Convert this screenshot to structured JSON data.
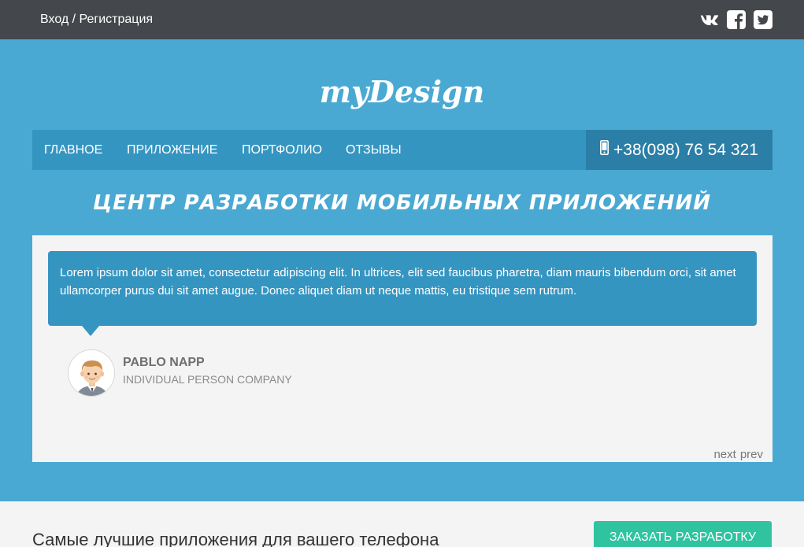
{
  "topbar": {
    "login_label": "Вход / Регистрация",
    "socials": [
      {
        "icon": "vk-icon",
        "label": "VK"
      },
      {
        "icon": "facebook-icon",
        "label": "f"
      },
      {
        "icon": "twitter-icon",
        "label": "Twitter"
      }
    ]
  },
  "brand": {
    "logo": "myDesign"
  },
  "nav": {
    "items": [
      {
        "label": "ГЛАВНОЕ"
      },
      {
        "label": "ПРИЛОЖЕНИЕ"
      },
      {
        "label": "ПОРТФОЛИО"
      },
      {
        "label": "ОТЗЫВЫ"
      }
    ],
    "phone": "+38(098) 76 54 321",
    "phone_icon": "mobile-phone-icon"
  },
  "hero": {
    "tagline": "Центр разработки мобильных приложений"
  },
  "testimonial": {
    "text": "Lorem ipsum dolor sit amet, consectetur adipiscing elit. In ultrices, elit sed faucibus pharetra, diam mauris bibendum orci, sit amet ullamcorper purus dui sit amet augue. Donec aliquet diam ut neque mattis, eu tristique sem rutrum.",
    "author_name": "PABLO NAPP",
    "author_company": "INDIVIDUAL PERSON COMPANY",
    "next_label": "next",
    "prev_label": "prev"
  },
  "bottom": {
    "headline": "Самые лучшие приложения для вашего телефона",
    "order_button": "ЗАКАЗАТЬ РАЗРАБОТКУ"
  },
  "colors": {
    "topbar_bg": "#44474b",
    "hero_bg": "#4aa9d3",
    "nav_bg": "#3595c1",
    "phone_bg": "#2b7fa7",
    "panel_bg": "#f4f4f4",
    "accent_green": "#2fc3a0"
  }
}
